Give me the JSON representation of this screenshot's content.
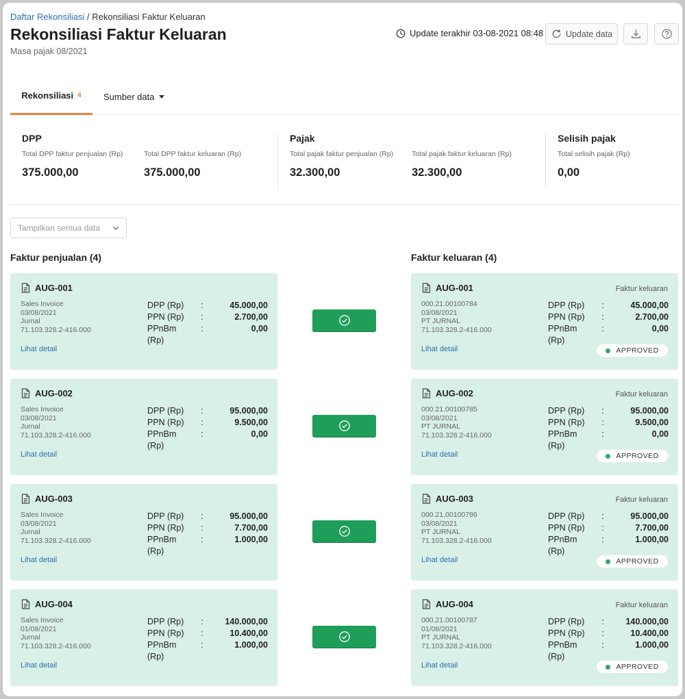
{
  "breadcrumb": {
    "parent": "Daftar Rekonsiliasi",
    "separator": " / ",
    "current": "Rekonsiliasi Faktur Keluaran"
  },
  "header": {
    "title": "Rekonsiliasi Faktur Keluaran",
    "subtitle": "Masa pajak 08/2021",
    "last_update": "Update terakhir 03-08-2021 08:48",
    "update_button": "Update data"
  },
  "tabs": {
    "rekonsiliasi": "Rekonsiliasi",
    "rekonsiliasi_count": "4",
    "sumber": "Sumber data"
  },
  "summary": {
    "dpp": {
      "title": "DPP",
      "penjualan_label": "Total DPP faktur penjualan (Rp)",
      "penjualan_value": "375.000,00",
      "keluaran_label": "Total DPP faktur keluaran (Rp)",
      "keluaran_value": "375.000,00"
    },
    "pajak": {
      "title": "Pajak",
      "penjualan_label": "Total pajak faktur penjualan (Rp)",
      "penjualan_value": "32.300,00",
      "keluaran_label": "Total pajak faktur keluaran (Rp)",
      "keluaran_value": "32.300,00"
    },
    "selisih": {
      "title": "Selisih pajak",
      "label": "Total selisih pajak (Rp)",
      "value": "0,00"
    }
  },
  "filter": {
    "placeholder": "Tampilkan semua data"
  },
  "labels": {
    "dpp": "DPP (Rp)",
    "ppn": "PPN (Rp)",
    "ppnbm": "PPnBm (Rp)",
    "colon": ":",
    "detail": "Lihat detail",
    "keluaran_type": "Faktur keluaran",
    "approved": "APPROVED"
  },
  "penjualan": {
    "title": "Faktur penjualan (4)",
    "items": [
      {
        "id": "AUG-001",
        "meta1": "Sales Invoice",
        "meta2": "03/08/2021",
        "meta3": "Jurnal",
        "meta4": "71.103.328.2-416.000",
        "dpp": "45.000,00",
        "ppn": "2.700,00",
        "ppnbm": "0,00"
      },
      {
        "id": "AUG-002",
        "meta1": "Sales Invoice",
        "meta2": "03/08/2021",
        "meta3": "Jurnal",
        "meta4": "71.103.328.2-416.000",
        "dpp": "95.000,00",
        "ppn": "9.500,00",
        "ppnbm": "0,00"
      },
      {
        "id": "AUG-003",
        "meta1": "Sales Invoice",
        "meta2": "03/08/2021",
        "meta3": "Jurnal",
        "meta4": "71.103.328.2-416.000",
        "dpp": "95.000,00",
        "ppn": "7.700,00",
        "ppnbm": "1.000,00"
      },
      {
        "id": "AUG-004",
        "meta1": "Sales Invoice",
        "meta2": "01/08/2021",
        "meta3": "Jurnal",
        "meta4": "71.103.328.2-416.000",
        "dpp": "140.000,00",
        "ppn": "10.400,00",
        "ppnbm": "1.000,00"
      }
    ]
  },
  "keluaran": {
    "title": "Faktur keluaran (4)",
    "items": [
      {
        "id": "AUG-001",
        "meta1": "000.21.00100784",
        "meta2": "03/08/2021",
        "meta3": "PT JURNAL",
        "meta4": "71.103.328.2-416.000",
        "dpp": "45.000,00",
        "ppn": "2.700,00",
        "ppnbm": "0,00"
      },
      {
        "id": "AUG-002",
        "meta1": "000.21.00100785",
        "meta2": "03/08/2021",
        "meta3": "PT JURNAL",
        "meta4": "71.103.328.2-416.000",
        "dpp": "95.000,00",
        "ppn": "9.500,00",
        "ppnbm": "0,00"
      },
      {
        "id": "AUG-003",
        "meta1": "000.21.00100786",
        "meta2": "03/08/2021",
        "meta3": "PT JURNAL",
        "meta4": "71.103.328.2-416.000",
        "dpp": "95.000,00",
        "ppn": "7.700,00",
        "ppnbm": "1.000,00"
      },
      {
        "id": "AUG-004",
        "meta1": "000.21.00100787",
        "meta2": "01/08/2021",
        "meta3": "PT JURNAL",
        "meta4": "71.103.328.2-416.000",
        "dpp": "140.000,00",
        "ppn": "10.400,00",
        "ppnbm": "1.000,00"
      }
    ]
  },
  "colors": {
    "accent": "#e8833a",
    "card_bg": "#d9f0e6",
    "match_button": "#1f9e5a",
    "link": "#2a6fb0",
    "status_dot": "#2eaa5c"
  },
  "icons": {
    "clock": "clock-icon",
    "refresh": "refresh-icon",
    "download": "download-icon",
    "help": "help-icon",
    "document": "document-icon",
    "check": "check-circle-icon",
    "chevron": "chevron-down-icon"
  }
}
